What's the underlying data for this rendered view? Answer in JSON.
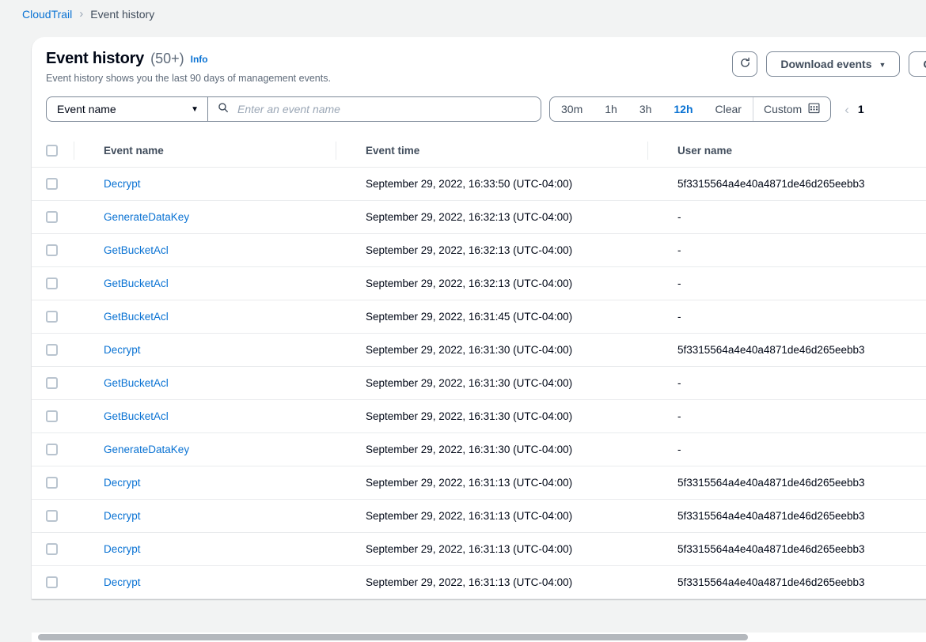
{
  "breadcrumb": {
    "root": "CloudTrail",
    "separator": "›",
    "current": "Event history"
  },
  "panel": {
    "title": "Event history",
    "count": "(50+)",
    "info_label": "Info",
    "subtitle": "Event history shows you the last 90 days of management events."
  },
  "actions": {
    "refresh_icon": "refresh-icon",
    "download_label": "Download events",
    "download_caret": "▼",
    "create_label": "Cr"
  },
  "filters": {
    "property_label": "Event name",
    "property_caret": "▼",
    "search_icon": "search-icon",
    "search_value": "",
    "search_placeholder": "Enter an event name",
    "ranges": [
      {
        "label": "30m",
        "active": false
      },
      {
        "label": "1h",
        "active": false
      },
      {
        "label": "3h",
        "active": false
      },
      {
        "label": "12h",
        "active": true
      },
      {
        "label": "Clear",
        "active": false
      }
    ],
    "custom_label": "Custom",
    "custom_icon": "calendar-icon"
  },
  "pagination": {
    "prev_arrow": "‹",
    "page": "1"
  },
  "table": {
    "columns": [
      "Event name",
      "Event time",
      "User name"
    ],
    "rows": [
      {
        "name": "Decrypt",
        "time": "September 29, 2022, 16:33:50 (UTC-04:00)",
        "user": "5f3315564a4e40a4871de46d265eebb3"
      },
      {
        "name": "GenerateDataKey",
        "time": "September 29, 2022, 16:32:13 (UTC-04:00)",
        "user": "-"
      },
      {
        "name": "GetBucketAcl",
        "time": "September 29, 2022, 16:32:13 (UTC-04:00)",
        "user": "-"
      },
      {
        "name": "GetBucketAcl",
        "time": "September 29, 2022, 16:32:13 (UTC-04:00)",
        "user": "-"
      },
      {
        "name": "GetBucketAcl",
        "time": "September 29, 2022, 16:31:45 (UTC-04:00)",
        "user": "-"
      },
      {
        "name": "Decrypt",
        "time": "September 29, 2022, 16:31:30 (UTC-04:00)",
        "user": "5f3315564a4e40a4871de46d265eebb3"
      },
      {
        "name": "GetBucketAcl",
        "time": "September 29, 2022, 16:31:30 (UTC-04:00)",
        "user": "-"
      },
      {
        "name": "GetBucketAcl",
        "time": "September 29, 2022, 16:31:30 (UTC-04:00)",
        "user": "-"
      },
      {
        "name": "GenerateDataKey",
        "time": "September 29, 2022, 16:31:30 (UTC-04:00)",
        "user": "-"
      },
      {
        "name": "Decrypt",
        "time": "September 29, 2022, 16:31:13 (UTC-04:00)",
        "user": "5f3315564a4e40a4871de46d265eebb3"
      },
      {
        "name": "Decrypt",
        "time": "September 29, 2022, 16:31:13 (UTC-04:00)",
        "user": "5f3315564a4e40a4871de46d265eebb3"
      },
      {
        "name": "Decrypt",
        "time": "September 29, 2022, 16:31:13 (UTC-04:00)",
        "user": "5f3315564a4e40a4871de46d265eebb3"
      },
      {
        "name": "Decrypt",
        "time": "September 29, 2022, 16:31:13 (UTC-04:00)",
        "user": "5f3315564a4e40a4871de46d265eebb3"
      }
    ]
  },
  "colors": {
    "link": "#0972d3",
    "page_bg": "#f2f3f3",
    "card_bg": "#ffffff",
    "text": "#000716",
    "muted": "#5f6b7a",
    "border": "#7d8998",
    "row_divider": "#e9ebed"
  }
}
